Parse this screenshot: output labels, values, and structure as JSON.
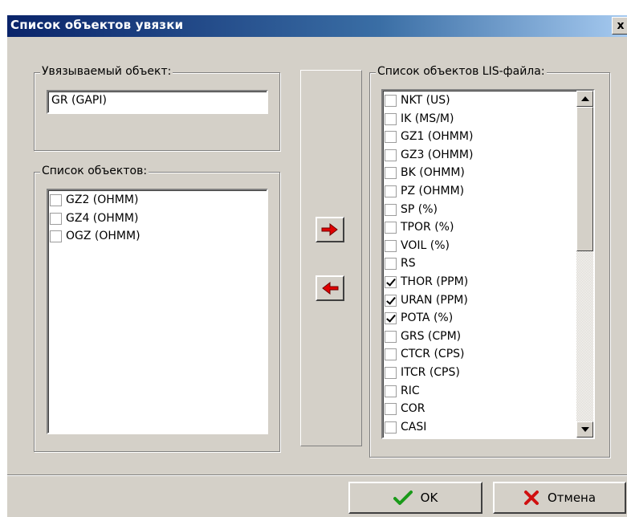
{
  "window": {
    "title": "Список объектов увязки",
    "close_label": "x"
  },
  "linked_object": {
    "legend": "Увязываемый объект:",
    "value": "GR (GAPI)"
  },
  "objects_list": {
    "legend": "Список объектов:",
    "items": [
      {
        "label": "GZ2 (OHMM)",
        "checked": false
      },
      {
        "label": "GZ4 (OHMM)",
        "checked": false
      },
      {
        "label": "OGZ (OHMM)",
        "checked": false
      }
    ]
  },
  "lis_list": {
    "legend": "Список объектов LIS-файла:",
    "items": [
      {
        "label": "NKT (US)",
        "checked": false
      },
      {
        "label": "IK (MS/M)",
        "checked": false
      },
      {
        "label": "GZ1 (OHMM)",
        "checked": false
      },
      {
        "label": "GZ3 (OHMM)",
        "checked": false
      },
      {
        "label": "BK (OHMM)",
        "checked": false
      },
      {
        "label": "PZ (OHMM)",
        "checked": false
      },
      {
        "label": "SP (%)",
        "checked": false
      },
      {
        "label": "TPOR (%)",
        "checked": false
      },
      {
        "label": "VOIL (%)",
        "checked": false
      },
      {
        "label": "RS",
        "checked": false
      },
      {
        "label": "THOR (PPM)",
        "checked": true
      },
      {
        "label": "URAN (PPM)",
        "checked": true
      },
      {
        "label": "POTA (%)",
        "checked": true
      },
      {
        "label": "GRS (CPM)",
        "checked": false
      },
      {
        "label": "CTCR (CPS)",
        "checked": false
      },
      {
        "label": "ITCR (CPS)",
        "checked": false
      },
      {
        "label": "RIC",
        "checked": false
      },
      {
        "label": "COR",
        "checked": false
      },
      {
        "label": "CASI",
        "checked": false
      }
    ]
  },
  "buttons": {
    "ok_label": "OK",
    "cancel_label": "Отмена"
  },
  "colors": {
    "arrow_red": "#e00000",
    "ok_green": "#1a9a1a",
    "cancel_red": "#d01010",
    "title_bar": "#0a246a"
  }
}
